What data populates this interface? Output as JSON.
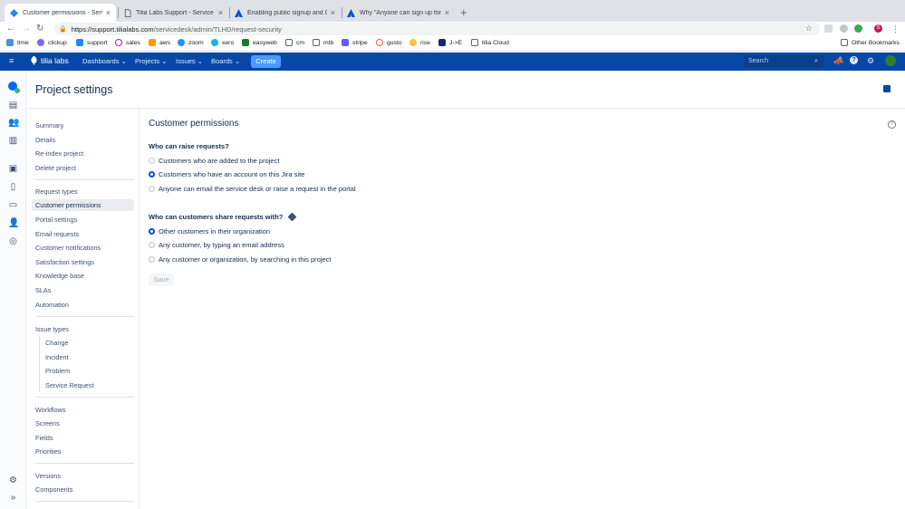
{
  "browser": {
    "tabs": [
      {
        "title": "Customer permissions - Servi",
        "active": true
      },
      {
        "title": "Tilia Labs Support - Service Dr",
        "active": false
      },
      {
        "title": "Enabling public signup and CAF",
        "active": false
      },
      {
        "title": "Why \"Anyone can sign up for a",
        "active": false
      }
    ],
    "url_host": "https://support.tilialabs.com",
    "url_path": "/servicedesk/admin/TLHD/request-security",
    "bookmarks": [
      "time",
      "clickup",
      "support",
      "sales",
      "aws",
      "zoom",
      "xero",
      "easyweb",
      "cm",
      "mtb",
      "stripe",
      "gusto",
      "rise",
      "J->E",
      "tilia Cloud"
    ],
    "other_bookmarks": "Other Bookmarks",
    "profile_initial": "S"
  },
  "jira_nav": {
    "logo": "tilia labs",
    "menus": [
      "Dashboards",
      "Projects",
      "Issues",
      "Boards"
    ],
    "create": "Create",
    "search_placeholder": "Search"
  },
  "page": {
    "title": "Project settings"
  },
  "sidebar": {
    "group1": [
      "Summary",
      "Details",
      "Re-index project",
      "Delete project"
    ],
    "group2": [
      "Request types",
      "Customer permissions",
      "Portal settings",
      "Email requests",
      "Customer notifications",
      "Satisfaction settings",
      "Knowledge base",
      "SLAs",
      "Automation"
    ],
    "issue_types_heading": "Issue types",
    "issue_types": [
      "Change",
      "Incident",
      "Problem",
      "Service Request"
    ],
    "group4": [
      "Workflows",
      "Screens",
      "Fields",
      "Priorities"
    ],
    "group5": [
      "Versions",
      "Components"
    ],
    "selected": "Customer permissions"
  },
  "content": {
    "title": "Customer permissions",
    "raise": {
      "question": "Who can raise requests?",
      "options": [
        "Customers who are added to the project",
        "Customers who have an account on this Jira site",
        "Anyone can email the service desk or raise a request in the portal"
      ],
      "selected_index": 1
    },
    "share": {
      "question": "Who can customers share requests with?",
      "options": [
        "Other customers in their organization",
        "Any customer, by typing an email address",
        "Any customer or organization, by searching in this project"
      ],
      "selected_index": 0
    },
    "save": "Save"
  },
  "colors": {
    "jira_nav_bg": "#0747a6",
    "create_bg": "#4c9aff",
    "radio_selected": "#0052cc"
  }
}
